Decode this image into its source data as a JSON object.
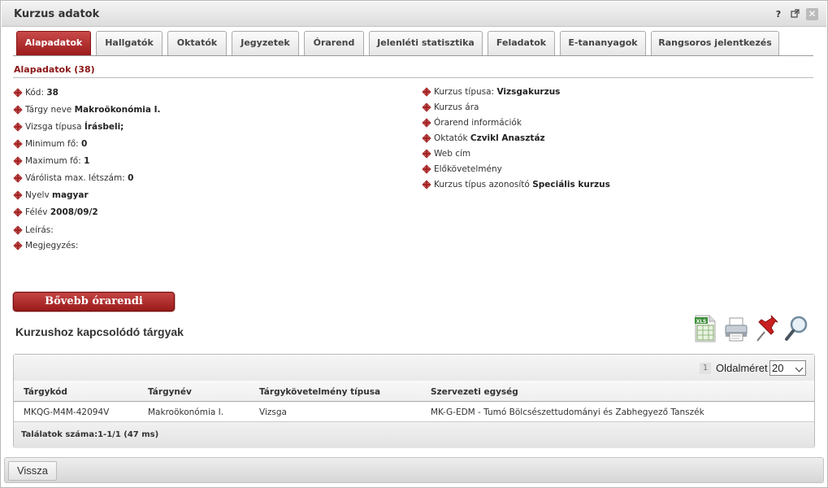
{
  "window": {
    "title": "Kurzus adatok"
  },
  "window_controls": {
    "help": "?",
    "close": "✕"
  },
  "tabs": [
    {
      "label": "Alapadatok",
      "active": true
    },
    {
      "label": "Hallgatók"
    },
    {
      "label": "Oktatók"
    },
    {
      "label": "Jegyzetek"
    },
    {
      "label": "Órarend"
    },
    {
      "label": "Jelenléti statisztika"
    },
    {
      "label": "Feladatok"
    },
    {
      "label": "E-tananyagok"
    },
    {
      "label": "Rangsoros jelentkezés"
    }
  ],
  "section": {
    "title": "Alapadatok (38)"
  },
  "left_fields": [
    {
      "label": "Kód:",
      "value": "38"
    },
    {
      "label": "Tárgy neve",
      "value": "Makroökonómia I."
    },
    {
      "label": "Vizsga típusa",
      "value": "Írásbeli;"
    },
    {
      "label": "Minimum fő:",
      "value": "0"
    },
    {
      "label": "Maximum fő:",
      "value": "1"
    },
    {
      "label": "Várólista max. létszám:",
      "value": "0"
    },
    {
      "label": "Nyelv",
      "value": "magyar"
    },
    {
      "label": "Félév",
      "value": "2008/09/2"
    },
    {
      "label": "Leírás:",
      "value": ""
    },
    {
      "label": "Megjegyzés:",
      "value": ""
    }
  ],
  "right_fields": [
    {
      "label": "Kurzus típusa:",
      "value": "Vizsgakurzus"
    },
    {
      "label": "Kurzus ára",
      "value": ""
    },
    {
      "label": "Órarend információk",
      "value": ""
    },
    {
      "label": "Oktatók",
      "value": "Czvikl Anasztáz"
    },
    {
      "label": "Web cím",
      "value": ""
    },
    {
      "label": "Előkövetelmény",
      "value": ""
    },
    {
      "label": "Kurzus típus azonosító",
      "value": "Speciális kurzus"
    }
  ],
  "more_button": {
    "label": "Bővebb órarendi információk"
  },
  "related": {
    "title": "Kurzushoz kapcsolódó tárgyak",
    "tools": {
      "excel_label": "XLS"
    },
    "pager": {
      "current_page": "1",
      "page_size_label": "Oldalméret",
      "page_size": "20"
    },
    "columns": [
      "Tárgykód",
      "Tárgynév",
      "Tárgykövetelmény típusa",
      "Szervezeti egység"
    ],
    "rows": [
      [
        "MKQG-M4M-42094V",
        "Makroökonómia I.",
        "Vizsga",
        "MK-G-EDM - Tumó Bölcsészettudományi és Zabhegyező Tanszék"
      ]
    ],
    "result_count": "Találatok száma:1-1/1 (47 ms)"
  },
  "footer": {
    "back_label": "Vissza"
  },
  "colors": {
    "accent": "#9c1b1b",
    "section_head": "#8a1515"
  }
}
